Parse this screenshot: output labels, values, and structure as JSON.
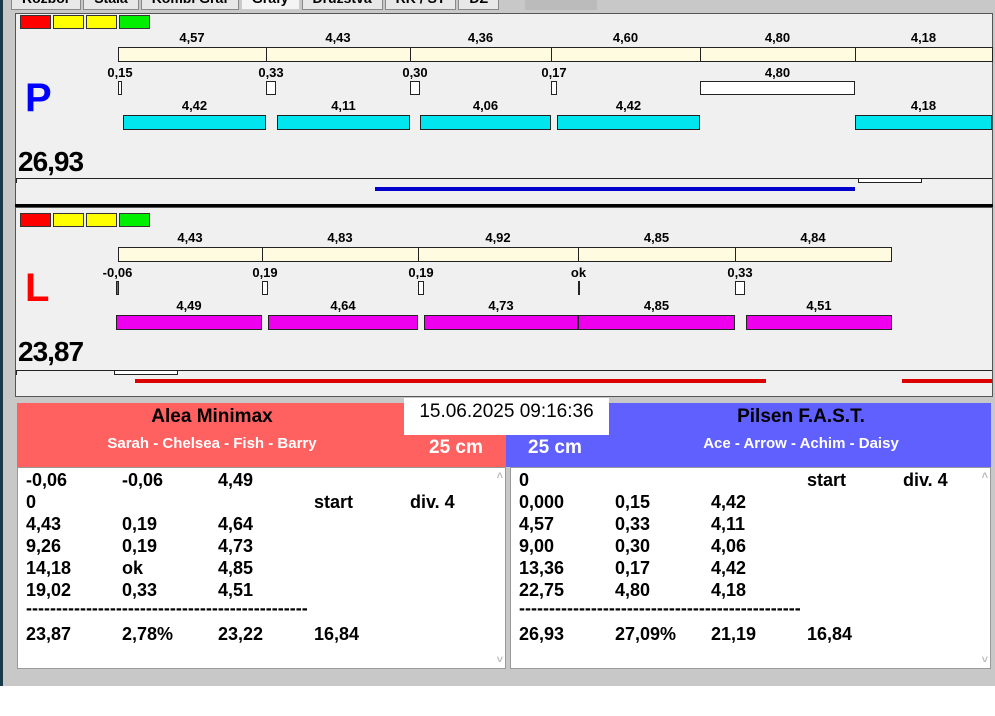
{
  "tabs": [
    "Rozbor",
    "Stala",
    "Kombi Graf",
    "Grafy",
    "Družstva",
    "RK / ST",
    "DZ"
  ],
  "active_tab": 3,
  "light_colors": [
    "#ff0000",
    "#ffff00",
    "#ffff00",
    "#00ee00"
  ],
  "lanes": [
    {
      "letter": "P",
      "letter_color": "#0000ff",
      "score": "26,93",
      "split_labels": [
        "4,57",
        "4,43",
        "4,36",
        "4,60",
        "4,80",
        "4,18"
      ],
      "reaction_labels": [
        "0,15",
        "0,33",
        "0,30",
        "0,17",
        "4,80"
      ],
      "run_labels": [
        "4,42",
        "4,11",
        "4,06",
        "4,42",
        "4,18"
      ],
      "run_color": "#00e5ee",
      "progress_color": "#0000cc"
    },
    {
      "letter": "L",
      "letter_color": "#ff0000",
      "score": "23,87",
      "split_labels": [
        "4,43",
        "4,83",
        "4,92",
        "4,85",
        "4,84"
      ],
      "reaction_labels": [
        "-0,06",
        "0,19",
        "0,19",
        "ok",
        "0,33"
      ],
      "run_labels": [
        "4,49",
        "4,64",
        "4,73",
        "4,85",
        "4,51"
      ],
      "run_color": "#ee00ee",
      "progress_color": "#dd0000"
    }
  ],
  "datetime": "15.06.2025 09:16:36",
  "teams": [
    {
      "name": "Alea Minimax",
      "members": "Sarah - Chelsea - Fish - Barry",
      "distance": "25 cm",
      "color": "#ff6060",
      "rows": [
        [
          "-0,06",
          "-0,06",
          "4,49",
          "",
          ""
        ],
        [
          "0",
          "",
          "",
          "start",
          "div. 4"
        ],
        [
          "4,43",
          "0,19",
          "4,64",
          "",
          ""
        ],
        [
          "9,26",
          "0,19",
          "4,73",
          "",
          ""
        ],
        [
          "14,18",
          "ok",
          "4,85",
          "",
          ""
        ],
        [
          "19,02",
          "0,33",
          "4,51",
          "",
          ""
        ]
      ],
      "separator": "-----------------------------------------------",
      "totals": [
        "23,87",
        "2,78%",
        "23,22",
        "16,84"
      ]
    },
    {
      "name": "Pilsen F.A.S.T.",
      "members": "Ace - Arrow - Achim - Daisy",
      "distance": "25 cm",
      "color": "#6060ff",
      "rows": [
        [
          "0",
          "",
          "",
          "start",
          "div. 4"
        ],
        [
          "0,000",
          "0,15",
          "4,42",
          "",
          ""
        ],
        [
          "4,57",
          "0,33",
          "4,11",
          "",
          ""
        ],
        [
          "9,00",
          "0,30",
          "4,06",
          "",
          ""
        ],
        [
          "13,36",
          "0,17",
          "4,42",
          "",
          ""
        ],
        [
          "22,75",
          "4,80",
          "4,18",
          "",
          ""
        ]
      ],
      "separator": "-----------------------------------------------",
      "totals": [
        "26,93",
        "27,09%",
        "21,19",
        "16,84"
      ]
    }
  ]
}
